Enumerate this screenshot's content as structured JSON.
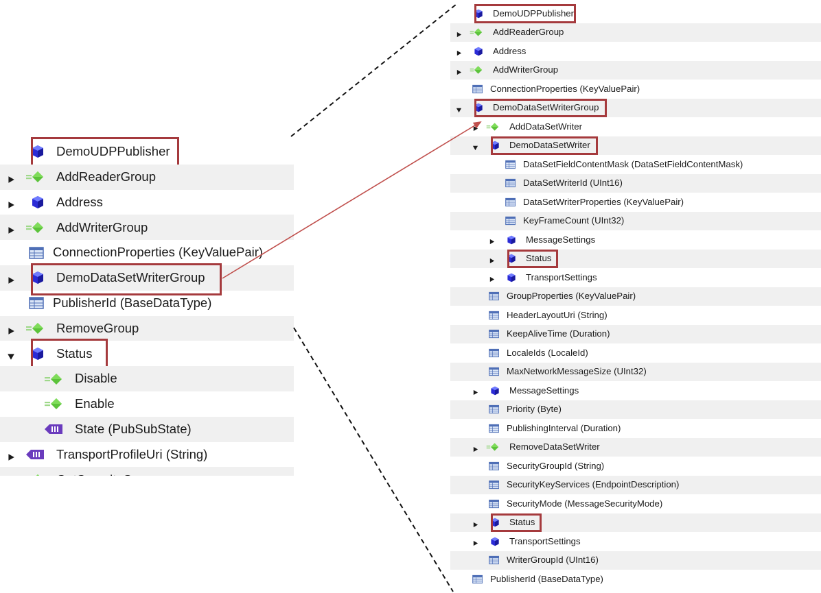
{
  "colors": {
    "highlight": "#a53a3d",
    "arrow": "#c0504d",
    "row_alt": "#f0f0f0",
    "object_icon": "#2b2bd6",
    "method_icon": "#5cc33b",
    "variable_icon": "#4f6fb6",
    "enum_icon": "#6a3bbd"
  },
  "left_tree": [
    {
      "label": "DemoUDPPublisher",
      "icon": "object-icon",
      "expander": "none",
      "indent": 0,
      "highlight": true
    },
    {
      "label": "AddReaderGroup",
      "icon": "method-icon",
      "expander": "collapsed",
      "indent": 0
    },
    {
      "label": "Address",
      "icon": "object-icon",
      "expander": "collapsed",
      "indent": 0
    },
    {
      "label": "AddWriterGroup",
      "icon": "method-icon",
      "expander": "collapsed",
      "indent": 0
    },
    {
      "label": "ConnectionProperties (KeyValuePair)",
      "icon": "variable-icon",
      "expander": "none",
      "indent": 0
    },
    {
      "label": "DemoDataSetWriterGroup",
      "icon": "object-icon",
      "expander": "collapsed",
      "indent": 0,
      "highlight": true
    },
    {
      "label": "PublisherId (BaseDataType)",
      "icon": "variable-icon",
      "expander": "none",
      "indent": 0
    },
    {
      "label": "RemoveGroup",
      "icon": "method-icon",
      "expander": "collapsed",
      "indent": 0
    },
    {
      "label": "Status",
      "icon": "object-icon",
      "expander": "expanded",
      "indent": 0,
      "highlight": true
    },
    {
      "label": "Disable",
      "icon": "method-icon",
      "expander": "none",
      "indent": 1
    },
    {
      "label": "Enable",
      "icon": "method-icon",
      "expander": "none",
      "indent": 1
    },
    {
      "label": "State (PubSubState)",
      "icon": "enum-icon",
      "expander": "none",
      "indent": 1
    },
    {
      "label": "TransportProfileUri (String)",
      "icon": "enum-icon",
      "expander": "collapsed",
      "indent": 0
    },
    {
      "label": "GetSecurityGroup",
      "icon": "method-icon",
      "expander": "none",
      "indent": 0,
      "clipped": true
    }
  ],
  "right_tree": [
    {
      "label": "DemoUDPPublisher",
      "icon": "object-icon",
      "expander": "none",
      "indent": 0,
      "highlight": true
    },
    {
      "label": "AddReaderGroup",
      "icon": "method-icon",
      "expander": "collapsed",
      "indent": 0
    },
    {
      "label": "Address",
      "icon": "object-icon",
      "expander": "collapsed",
      "indent": 0
    },
    {
      "label": "AddWriterGroup",
      "icon": "method-icon",
      "expander": "collapsed",
      "indent": 0
    },
    {
      "label": "ConnectionProperties (KeyValuePair)",
      "icon": "variable-icon",
      "expander": "none",
      "indent": 0
    },
    {
      "label": "DemoDataSetWriterGroup",
      "icon": "object-icon",
      "expander": "expanded",
      "indent": 0,
      "highlight": true
    },
    {
      "label": "AddDataSetWriter",
      "icon": "method-icon",
      "expander": "collapsed",
      "indent": 1
    },
    {
      "label": "DemoDataSetWriter",
      "icon": "object-icon",
      "expander": "expanded",
      "indent": 1,
      "highlight": true
    },
    {
      "label": "DataSetFieldContentMask (DataSetFieldContentMask)",
      "icon": "variable-icon",
      "expander": "none",
      "indent": 2
    },
    {
      "label": "DataSetWriterId (UInt16)",
      "icon": "variable-icon",
      "expander": "none",
      "indent": 2
    },
    {
      "label": "DataSetWriterProperties (KeyValuePair)",
      "icon": "variable-icon",
      "expander": "none",
      "indent": 2
    },
    {
      "label": "KeyFrameCount (UInt32)",
      "icon": "variable-icon",
      "expander": "none",
      "indent": 2
    },
    {
      "label": "MessageSettings",
      "icon": "object-icon",
      "expander": "collapsed",
      "indent": 2
    },
    {
      "label": "Status",
      "icon": "object-icon",
      "expander": "collapsed",
      "indent": 2,
      "highlight": true
    },
    {
      "label": "TransportSettings",
      "icon": "object-icon",
      "expander": "collapsed",
      "indent": 2
    },
    {
      "label": "GroupProperties (KeyValuePair)",
      "icon": "variable-icon",
      "expander": "none",
      "indent": 1
    },
    {
      "label": "HeaderLayoutUri (String)",
      "icon": "variable-icon",
      "expander": "none",
      "indent": 1
    },
    {
      "label": "KeepAliveTime (Duration)",
      "icon": "variable-icon",
      "expander": "none",
      "indent": 1
    },
    {
      "label": "LocaleIds (LocaleId)",
      "icon": "variable-icon",
      "expander": "none",
      "indent": 1
    },
    {
      "label": "MaxNetworkMessageSize (UInt32)",
      "icon": "variable-icon",
      "expander": "none",
      "indent": 1
    },
    {
      "label": "MessageSettings",
      "icon": "object-icon",
      "expander": "collapsed",
      "indent": 1
    },
    {
      "label": "Priority (Byte)",
      "icon": "variable-icon",
      "expander": "none",
      "indent": 1
    },
    {
      "label": "PublishingInterval (Duration)",
      "icon": "variable-icon",
      "expander": "none",
      "indent": 1
    },
    {
      "label": "RemoveDataSetWriter",
      "icon": "method-icon",
      "expander": "collapsed",
      "indent": 1
    },
    {
      "label": "SecurityGroupId (String)",
      "icon": "variable-icon",
      "expander": "none",
      "indent": 1
    },
    {
      "label": "SecurityKeyServices (EndpointDescription)",
      "icon": "variable-icon",
      "expander": "none",
      "indent": 1
    },
    {
      "label": "SecurityMode (MessageSecurityMode)",
      "icon": "variable-icon",
      "expander": "none",
      "indent": 1
    },
    {
      "label": "Status",
      "icon": "object-icon",
      "expander": "collapsed",
      "indent": 1,
      "highlight": true
    },
    {
      "label": "TransportSettings",
      "icon": "object-icon",
      "expander": "collapsed",
      "indent": 1
    },
    {
      "label": "WriterGroupId (UInt16)",
      "icon": "variable-icon",
      "expander": "none",
      "indent": 1
    },
    {
      "label": "PublisherId (BaseDataType)",
      "icon": "variable-icon",
      "expander": "none",
      "indent": 0
    }
  ]
}
